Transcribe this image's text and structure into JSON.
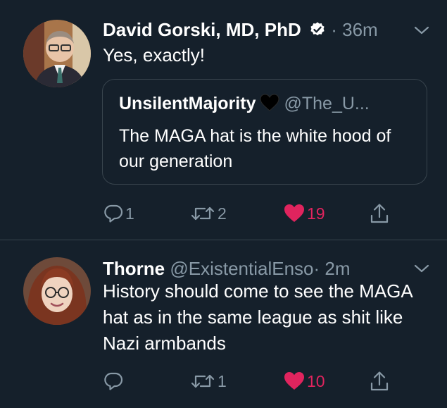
{
  "tweets": [
    {
      "name": "David Gorski, MD, PhD",
      "dot": "·",
      "time": "36m",
      "text": "Yes, exactly!",
      "verified": true,
      "quote": {
        "name": "UnsilentMajority",
        "emoji": "black-heart-icon",
        "handle": "@The_U...",
        "text": "The MAGA hat is the white hood of our generation"
      },
      "reply_count": "1",
      "retweet_count": "2",
      "like_count": "19",
      "liked": true
    },
    {
      "name": "Thorne",
      "handle": "@ExistentialEnso",
      "dot": "·",
      "time": "2m",
      "text": "History should come to see the MAGA hat as in the same league as shit like Nazi armbands",
      "verified": false,
      "reply_count": "",
      "retweet_count": "1",
      "like_count": "10",
      "liked": true
    }
  ],
  "colors": {
    "background": "#15202b",
    "secondary_text": "#8899a6",
    "like": "#e0245e",
    "border": "#38444d"
  }
}
